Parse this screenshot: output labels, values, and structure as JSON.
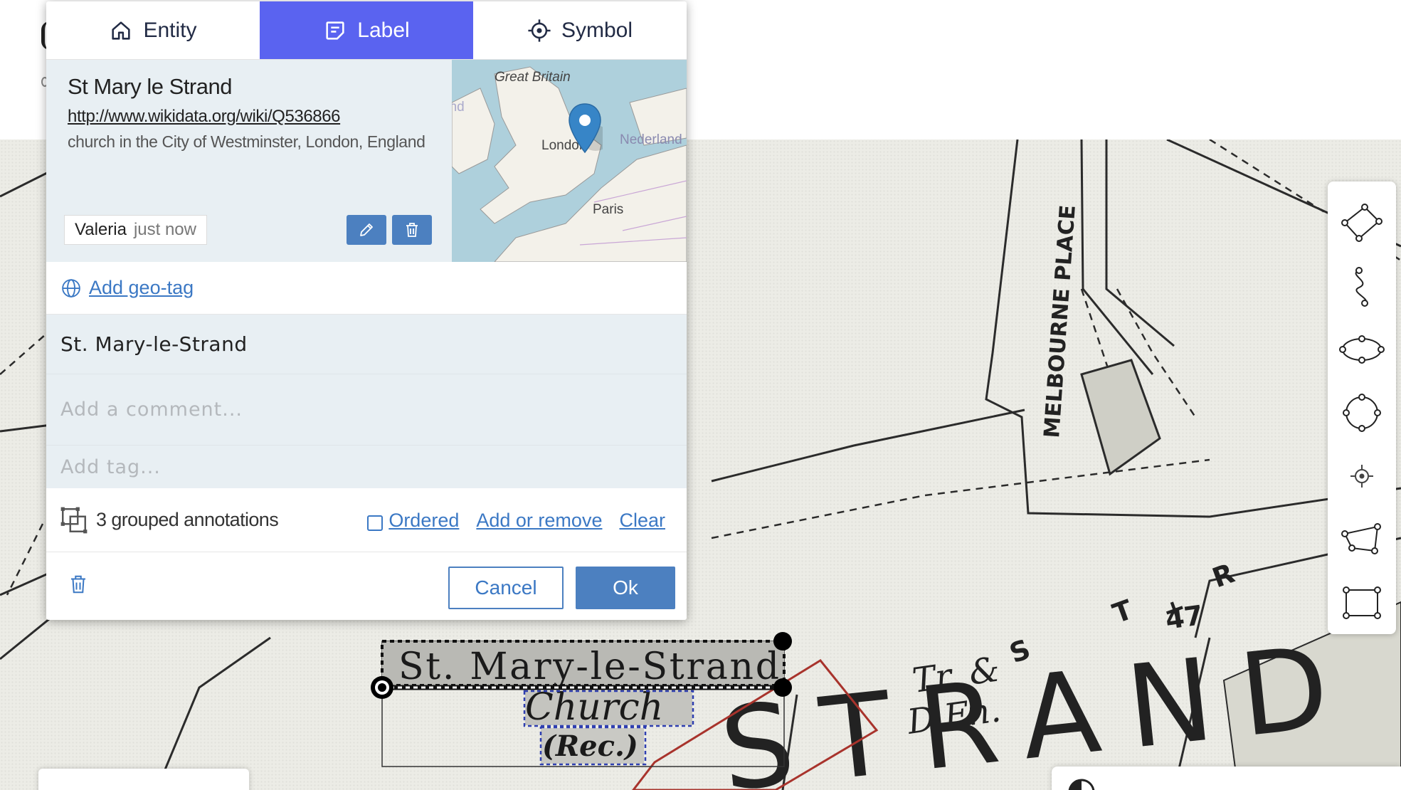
{
  "tabs": [
    {
      "label": "Entity",
      "icon": "home-icon"
    },
    {
      "label": "Label",
      "icon": "note-icon",
      "active": true
    },
    {
      "label": "Symbol",
      "icon": "crosshair-icon"
    }
  ],
  "entity": {
    "title": "St Mary le Strand",
    "url": "http://www.wikidata.org/wiki/Q536866",
    "description": "church in the City of Westminster, London, England",
    "creator": "Valeria",
    "created": "just now",
    "mini_map_labels": {
      "great_britain": "Great Britain",
      "ireland": "Éire / Ireland",
      "london": "London",
      "netherlands": "Nederland",
      "paris": "Paris"
    }
  },
  "geotag": {
    "link": "Add geo-tag"
  },
  "label_value": "St. Mary-le-Strand",
  "comment": {
    "placeholder": "Add a comment..."
  },
  "tags": {
    "placeholder": "Add tag..."
  },
  "grouping": {
    "text": "3 grouped annotations",
    "ordered": "Ordered",
    "add_remove": "Add or remove",
    "clear": "Clear"
  },
  "footer": {
    "cancel": "Cancel",
    "ok": "Ok"
  },
  "map_text": {
    "melbourne_place": "MELBOURNE PLACE",
    "label_line1": "St. Mary-le-Strand",
    "label_line2": "Church",
    "label_line3": "(Rec.)",
    "tr_dfn_1": "Tr. &",
    "tr_dfn_2": "D.Fn.",
    "strand": "STRAND",
    "st_r_s": "S",
    "st_r_t": "T",
    "st_r_r": "R",
    "number_47": "47"
  },
  "tools": [
    "line-tool-icon",
    "freehand-tool-icon",
    "ellipse-tool-icon",
    "circle-tool-icon",
    "point-tool-icon",
    "polygon-tool-icon",
    "rectangle-tool-icon"
  ],
  "colors": {
    "accent": "#5a63f0",
    "button": "#4c80c0",
    "link": "#3b78c4",
    "selection_outline": "#a8332c"
  }
}
